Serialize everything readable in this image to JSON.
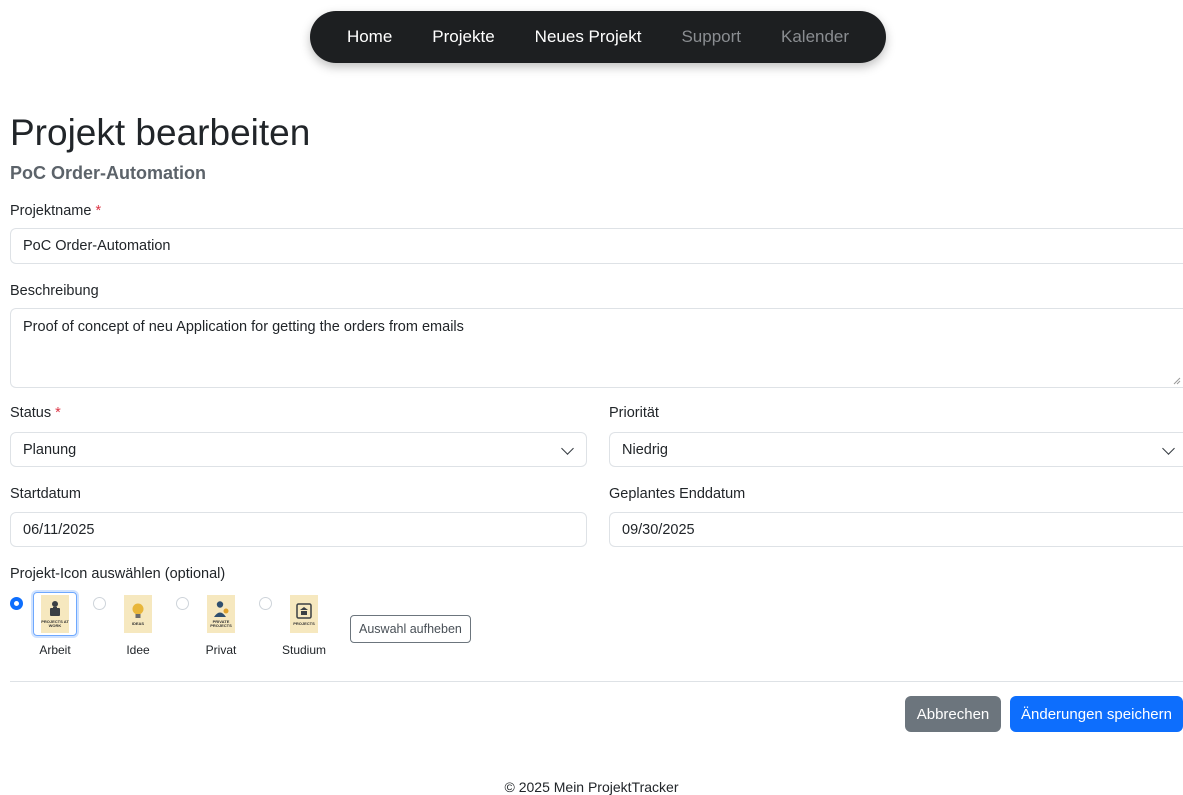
{
  "nav": {
    "items": [
      {
        "label": "Home"
      },
      {
        "label": "Projekte"
      },
      {
        "label": "Neues Projekt"
      },
      {
        "label": "Support"
      },
      {
        "label": "Kalender"
      }
    ]
  },
  "page": {
    "title": "Projekt bearbeiten",
    "subtitle": "PoC Order-Automation"
  },
  "form": {
    "required_marker": "*",
    "name": {
      "label": "Projektname",
      "value": "PoC Order-Automation"
    },
    "description": {
      "label": "Beschreibung",
      "value": "Proof of concept of neu Application for getting the orders from emails"
    },
    "status": {
      "label": "Status",
      "value": "Planung"
    },
    "priority": {
      "label": "Priorität",
      "value": "Niedrig"
    },
    "start_date": {
      "label": "Startdatum",
      "value": "06/11/2025"
    },
    "end_date": {
      "label": "Geplantes Enddatum",
      "value": "09/30/2025"
    },
    "icon_picker": {
      "label": "Projekt-Icon auswählen (optional)",
      "options": [
        {
          "label": "Arbeit",
          "caption": "PROJECTS AT WORK",
          "icon": "briefcase-person-icon",
          "selected": true
        },
        {
          "label": "Idee",
          "caption": "IDEAS",
          "icon": "lightbulb-icon",
          "selected": false
        },
        {
          "label": "Privat",
          "caption": "PRIVATE PROJECTS",
          "icon": "person-icon",
          "selected": false
        },
        {
          "label": "Studium",
          "caption": "PROJECTS",
          "icon": "university-icon",
          "selected": false
        }
      ],
      "clear_label": "Auswahl aufheben"
    }
  },
  "actions": {
    "cancel_label": "Abbrechen",
    "save_label": "Änderungen speichern"
  },
  "footer": {
    "text": "© 2025 Mein ProjektTracker"
  },
  "colors": {
    "primary": "#0d6efd",
    "secondary": "#6c757d",
    "required": "#dc3545",
    "navbar": "#1d1f21"
  }
}
